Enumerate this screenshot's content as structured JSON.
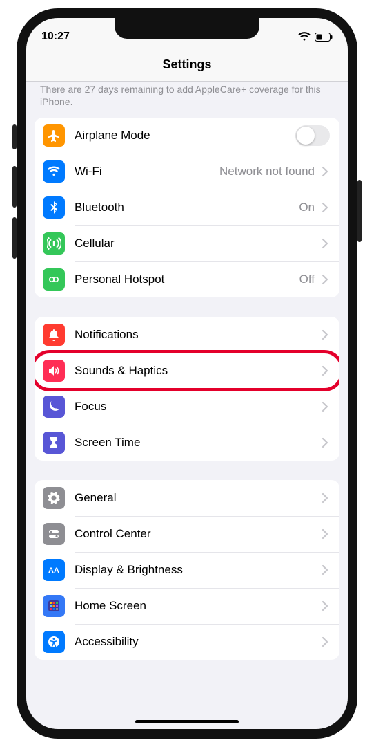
{
  "status": {
    "time": "10:27"
  },
  "navbar": {
    "title": "Settings"
  },
  "info_text": "There are 27 days remaining to add AppleCare+ coverage for this iPhone.",
  "groups": [
    {
      "rows": [
        {
          "icon": "airplane",
          "color": "bg-orange",
          "label": "Airplane Mode",
          "control": "toggle"
        },
        {
          "icon": "wifi",
          "color": "bg-blue",
          "label": "Wi-Fi",
          "value": "Network not found",
          "control": "chevron"
        },
        {
          "icon": "bluetooth",
          "color": "bg-blue",
          "label": "Bluetooth",
          "value": "On",
          "control": "chevron"
        },
        {
          "icon": "cellular",
          "color": "bg-green",
          "label": "Cellular",
          "control": "chevron"
        },
        {
          "icon": "hotspot",
          "color": "bg-green",
          "label": "Personal Hotspot",
          "value": "Off",
          "control": "chevron"
        }
      ]
    },
    {
      "rows": [
        {
          "icon": "bell",
          "color": "bg-red",
          "label": "Notifications",
          "control": "chevron"
        },
        {
          "icon": "speaker",
          "color": "bg-pink",
          "label": "Sounds & Haptics",
          "control": "chevron",
          "highlight": true
        },
        {
          "icon": "moon",
          "color": "bg-indigo",
          "label": "Focus",
          "control": "chevron"
        },
        {
          "icon": "hourglass",
          "color": "bg-indigo",
          "label": "Screen Time",
          "control": "chevron"
        }
      ]
    },
    {
      "rows": [
        {
          "icon": "gear",
          "color": "bg-gray",
          "label": "General",
          "control": "chevron"
        },
        {
          "icon": "switches",
          "color": "bg-gray",
          "label": "Control Center",
          "control": "chevron"
        },
        {
          "icon": "aa",
          "color": "bg-blue",
          "label": "Display & Brightness",
          "control": "chevron"
        },
        {
          "icon": "grid",
          "color": "bg-deepblue",
          "label": "Home Screen",
          "control": "chevron"
        },
        {
          "icon": "accessibility",
          "color": "bg-blue",
          "label": "Accessibility",
          "control": "chevron"
        }
      ]
    }
  ]
}
